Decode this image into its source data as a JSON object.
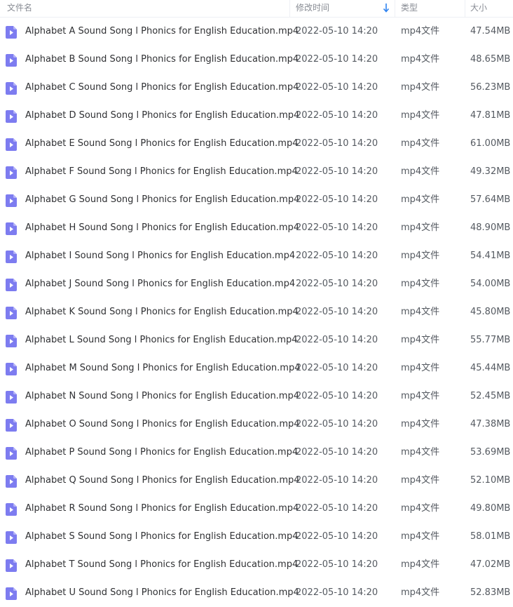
{
  "header": {
    "name": "文件名",
    "modified": "修改时间",
    "type": "类型",
    "size": "大小"
  },
  "colors": {
    "icon": "#7d7cf0",
    "header_text": "#888c94",
    "sort_arrow": "#2f83f0"
  },
  "file_icon": "video-file-icon",
  "files": [
    {
      "name": "Alphabet A Sound Song l Phonics for English Education.mp4",
      "modified": "2022-05-10 14:20",
      "type": "mp4文件",
      "size": "47.54MB"
    },
    {
      "name": "Alphabet B Sound Song l Phonics for English Education.mp4",
      "modified": "2022-05-10 14:20",
      "type": "mp4文件",
      "size": "48.65MB"
    },
    {
      "name": "Alphabet C Sound Song l Phonics for English Education.mp4",
      "modified": "2022-05-10 14:20",
      "type": "mp4文件",
      "size": "56.23MB"
    },
    {
      "name": "Alphabet D Sound Song l Phonics for English Education.mp4",
      "modified": "2022-05-10 14:20",
      "type": "mp4文件",
      "size": "47.81MB"
    },
    {
      "name": "Alphabet E Sound Song l Phonics for English Education.mp4",
      "modified": "2022-05-10 14:20",
      "type": "mp4文件",
      "size": "61.00MB"
    },
    {
      "name": "Alphabet F Sound Song l Phonics for English Education.mp4",
      "modified": "2022-05-10 14:20",
      "type": "mp4文件",
      "size": "49.32MB"
    },
    {
      "name": "Alphabet G Sound Song l Phonics for English Education.mp4",
      "modified": "2022-05-10 14:20",
      "type": "mp4文件",
      "size": "57.64MB"
    },
    {
      "name": "Alphabet H Sound Song l Phonics for English Education.mp4",
      "modified": "2022-05-10 14:20",
      "type": "mp4文件",
      "size": "48.90MB"
    },
    {
      "name": "Alphabet I Sound Song l Phonics for English Education.mp4",
      "modified": "2022-05-10 14:20",
      "type": "mp4文件",
      "size": "54.41MB"
    },
    {
      "name": "Alphabet J Sound Song l Phonics for English Education.mp4",
      "modified": "2022-05-10 14:20",
      "type": "mp4文件",
      "size": "54.00MB"
    },
    {
      "name": "Alphabet K Sound Song l Phonics for English Education.mp4",
      "modified": "2022-05-10 14:20",
      "type": "mp4文件",
      "size": "45.80MB"
    },
    {
      "name": "Alphabet L Sound Song l Phonics for English Education.mp4",
      "modified": "2022-05-10 14:20",
      "type": "mp4文件",
      "size": "55.77MB"
    },
    {
      "name": "Alphabet M Sound Song l Phonics for English Education.mp4",
      "modified": "2022-05-10 14:20",
      "type": "mp4文件",
      "size": "45.44MB"
    },
    {
      "name": "Alphabet N Sound Song l Phonics for English Education.mp4",
      "modified": "2022-05-10 14:20",
      "type": "mp4文件",
      "size": "52.45MB"
    },
    {
      "name": "Alphabet O Sound Song l Phonics for English Education.mp4",
      "modified": "2022-05-10 14:20",
      "type": "mp4文件",
      "size": "47.38MB"
    },
    {
      "name": "Alphabet P Sound Song l Phonics for English Education.mp4",
      "modified": "2022-05-10 14:20",
      "type": "mp4文件",
      "size": "53.69MB"
    },
    {
      "name": "Alphabet Q Sound Song l Phonics for English Education.mp4",
      "modified": "2022-05-10 14:20",
      "type": "mp4文件",
      "size": "52.10MB"
    },
    {
      "name": "Alphabet R Sound Song l Phonics for English Education.mp4",
      "modified": "2022-05-10 14:20",
      "type": "mp4文件",
      "size": "49.80MB"
    },
    {
      "name": "Alphabet S Sound Song l Phonics for English Education.mp4",
      "modified": "2022-05-10 14:20",
      "type": "mp4文件",
      "size": "58.01MB"
    },
    {
      "name": "Alphabet T Sound Song l Phonics for English Education.mp4",
      "modified": "2022-05-10 14:20",
      "type": "mp4文件",
      "size": "47.02MB"
    },
    {
      "name": "Alphabet U Sound Song l Phonics for English Education.mp4",
      "modified": "2022-05-10 14:20",
      "type": "mp4文件",
      "size": "52.83MB"
    }
  ]
}
